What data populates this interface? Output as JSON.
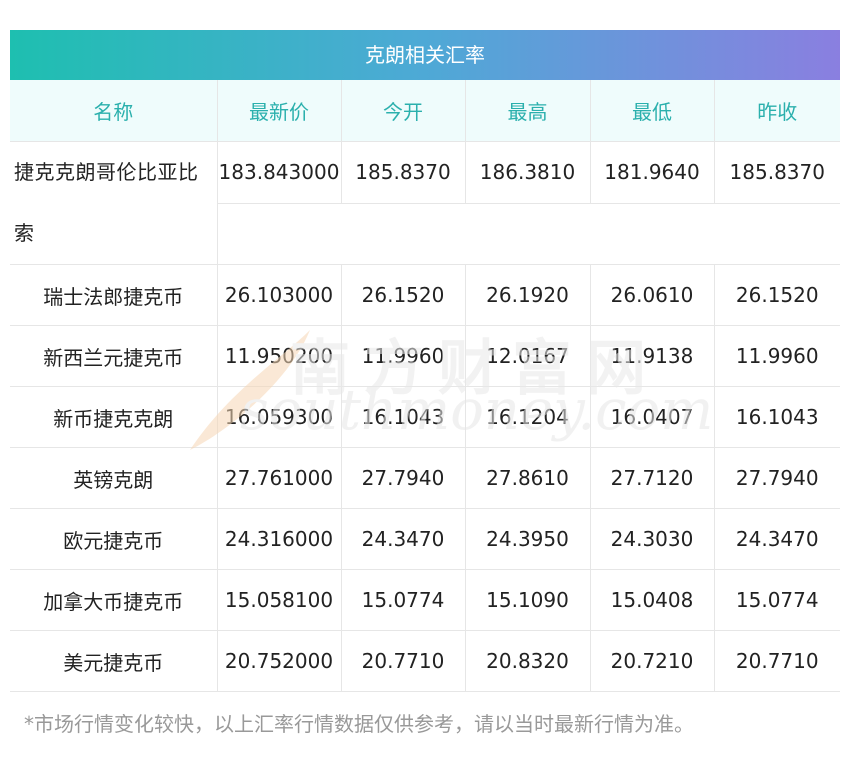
{
  "title": "克朗相关汇率",
  "columns": [
    "名称",
    "最新价",
    "今开",
    "最高",
    "最低",
    "昨收"
  ],
  "rows": [
    {
      "name": "捷克克朗哥伦比亚比索",
      "latest": "183.843000",
      "open": "185.8370",
      "high": "186.3810",
      "low": "181.9640",
      "prev": "185.8370"
    },
    {
      "name": "瑞士法郎捷克币",
      "latest": "26.103000",
      "open": "26.1520",
      "high": "26.1920",
      "low": "26.0610",
      "prev": "26.1520"
    },
    {
      "name": "新西兰元捷克币",
      "latest": "11.950200",
      "open": "11.9960",
      "high": "12.0167",
      "low": "11.9138",
      "prev": "11.9960"
    },
    {
      "name": "新币捷克克朗",
      "latest": "16.059300",
      "open": "16.1043",
      "high": "16.1204",
      "low": "16.0407",
      "prev": "16.1043"
    },
    {
      "name": "英镑克朗",
      "latest": "27.761000",
      "open": "27.7940",
      "high": "27.8610",
      "low": "27.7120",
      "prev": "27.7940"
    },
    {
      "name": "欧元捷克币",
      "latest": "24.316000",
      "open": "24.3470",
      "high": "24.3950",
      "low": "24.3030",
      "prev": "24.3470"
    },
    {
      "name": "加拿大币捷克币",
      "latest": "15.058100",
      "open": "15.0774",
      "high": "15.1090",
      "low": "15.0408",
      "prev": "15.0774"
    },
    {
      "name": "美元捷克币",
      "latest": "20.752000",
      "open": "20.7710",
      "high": "20.8320",
      "low": "20.7210",
      "prev": "20.7710"
    }
  ],
  "note": "*市场行情变化较快，以上汇率行情数据仅供参考，请以当时最新行情为准。",
  "watermark": {
    "cn": "南方财富网",
    "en": "southmoney.com"
  },
  "colors": {
    "header_text": "#2bb0ad",
    "header_bg": "#effcfc",
    "title_gradient_start": "#1ebfb0",
    "title_gradient_end": "#8a7fe0"
  }
}
